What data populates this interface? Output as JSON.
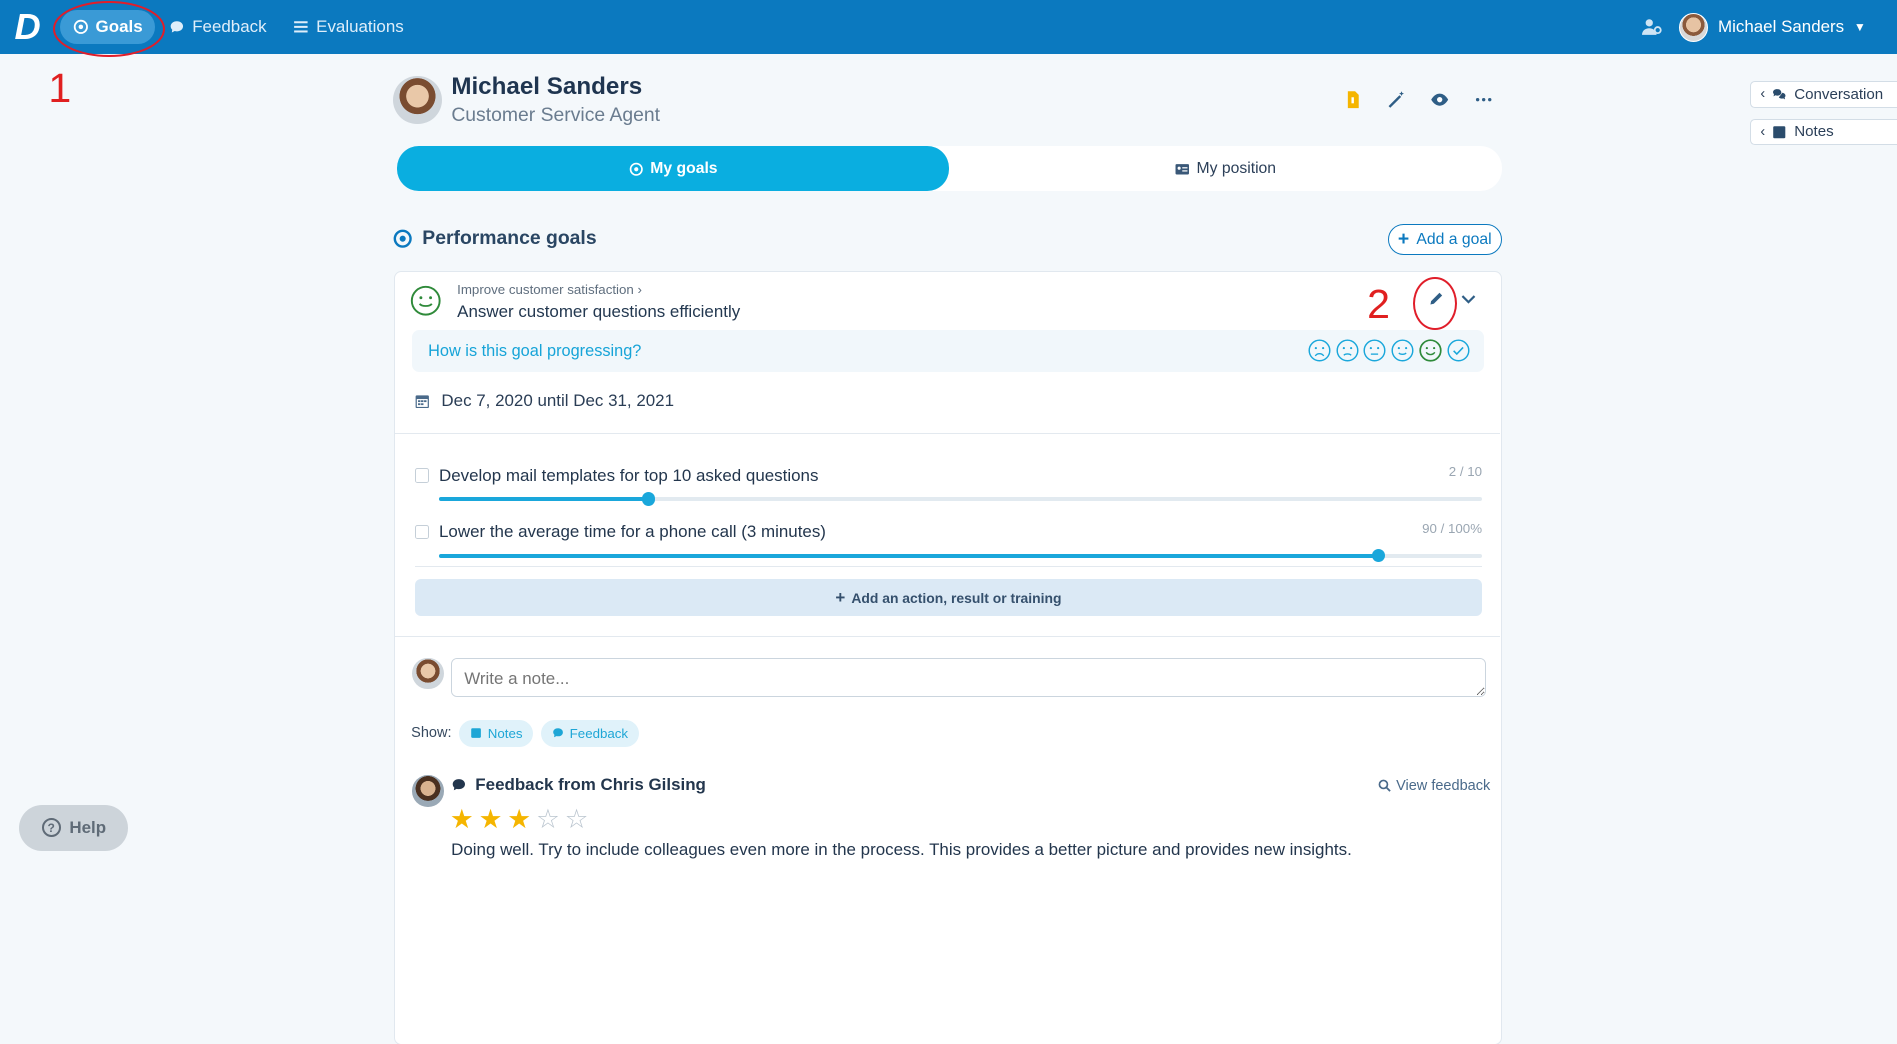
{
  "nav": {
    "logo": "D",
    "items": [
      {
        "label": "Goals",
        "icon": "target-icon"
      },
      {
        "label": "Feedback",
        "icon": "chat-bubble-icon"
      },
      {
        "label": "Evaluations",
        "icon": "list-icon"
      }
    ],
    "user_name": "Michael Sanders"
  },
  "annotations": {
    "one": "1",
    "two": "2"
  },
  "profile": {
    "name": "Michael Sanders",
    "role": "Customer Service Agent"
  },
  "tabs": [
    {
      "label": "My goals"
    },
    {
      "label": "My position"
    }
  ],
  "section": {
    "title": "Performance goals",
    "add_goal_label": "Add a goal"
  },
  "goal": {
    "parent": "Improve customer satisfaction",
    "title": "Answer customer questions efficiently",
    "progress_question": "How is this goal progressing?",
    "dates": "Dec 7, 2020 until Dec 31, 2021",
    "actions": [
      {
        "label": "Develop mail templates for top 10 asked questions",
        "value": "2 / 10",
        "progress": 0.2
      },
      {
        "label": "Lower the average time for a phone call (3 minutes)",
        "value": "90 / 100%",
        "progress": 0.9
      }
    ],
    "add_action_label": "Add an action, result or training"
  },
  "notes": {
    "placeholder": "Write a note...",
    "show_label": "Show:",
    "filters": [
      "Notes",
      "Feedback"
    ]
  },
  "feedback": {
    "title": "Feedback from Chris Gilsing",
    "view_label": "View feedback",
    "rating": 3,
    "max_rating": 5,
    "text": "Doing well. Try to include colleagues even more in the process. This provides a better picture and provides new insights."
  },
  "side": {
    "conversation": "Conversation",
    "notes": "Notes"
  },
  "help": {
    "label": "Help"
  },
  "colors": {
    "primary": "#0b79bf",
    "accent": "#0aaee0",
    "annotation": "#e01e2a",
    "star": "#f5b500"
  }
}
